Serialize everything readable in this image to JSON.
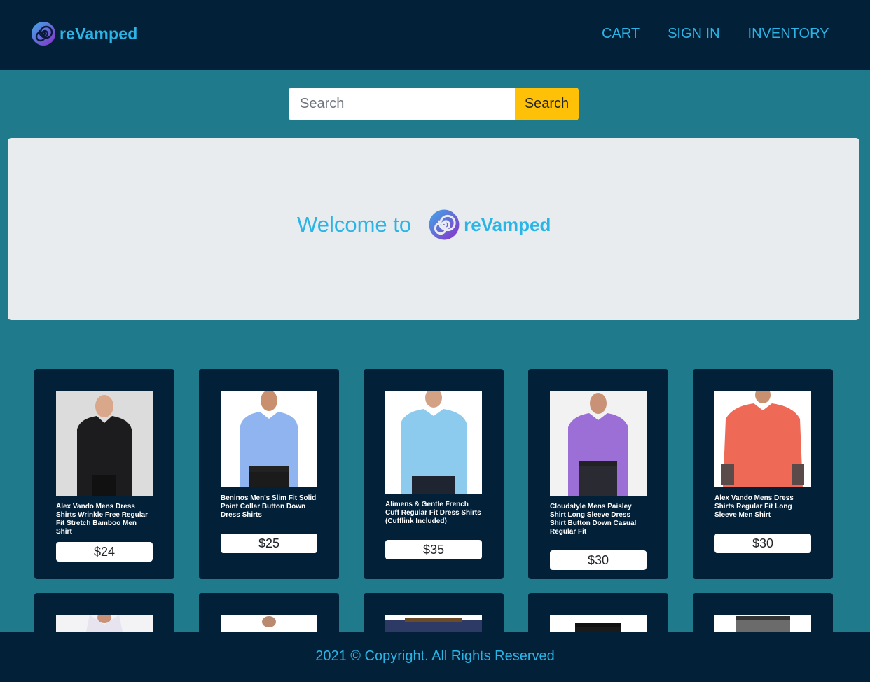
{
  "header": {
    "brand": "reVamped",
    "nav": [
      {
        "label": "CART"
      },
      {
        "label": "SIGN IN"
      },
      {
        "label": "INVENTORY"
      }
    ]
  },
  "search": {
    "placeholder": "Search",
    "button_label": "Search"
  },
  "hero": {
    "welcome_text": "Welcome to",
    "brand": "reVamped"
  },
  "products": [
    {
      "name": "Alex Vando Mens Dress Shirts Wrinkle Free Regular Fit Stretch Bamboo Men Shirt",
      "price": "$24",
      "shirt_color": "#1c1c1e",
      "bg": "#dcdcdc"
    },
    {
      "name": "Beninos Men's Slim Fit Solid Point Collar Button Down Dress Shirts",
      "price": "$25",
      "shirt_color": "#8fb4ef",
      "bg": "#ffffff"
    },
    {
      "name": "Alimens & Gentle French Cuff Regular Fit Dress Shirts (Cufflink Included)",
      "price": "$35",
      "shirt_color": "#8ccbee",
      "bg": "#ffffff"
    },
    {
      "name": "Cloudstyle Mens Paisley Shirt Long Sleeve Dress Shirt Button Down Casual Regular Fit",
      "price": "$30",
      "shirt_color": "#9b6fd6",
      "bg": "#f2f2f2"
    },
    {
      "name": "Alex Vando Mens Dress Shirts Regular Fit Long Sleeve Men Shirt",
      "price": "$30",
      "shirt_color": "#ef6a56",
      "bg": "#ffffff"
    }
  ],
  "footer": {
    "text": "2021 © Copyright. All Rights Reserved"
  },
  "colors": {
    "navy": "#022038",
    "teal": "#1f7a8c",
    "accent": "#2bb5e6",
    "search_button": "#ffc107"
  }
}
